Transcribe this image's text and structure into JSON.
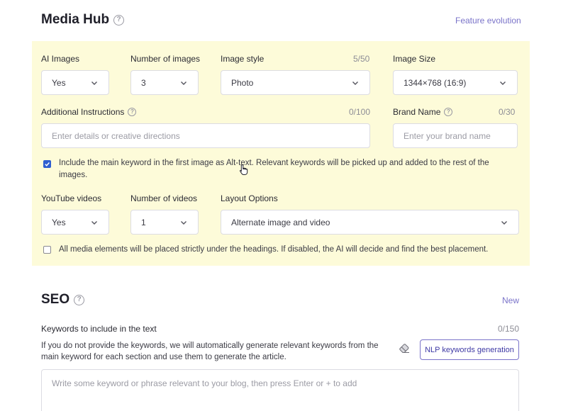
{
  "media_hub": {
    "title": "Media Hub",
    "feature_link": "Feature evolution",
    "ai_images": {
      "label": "AI Images",
      "value": "Yes"
    },
    "num_images": {
      "label": "Number of images",
      "value": "3"
    },
    "image_style": {
      "label": "Image style",
      "counter": "5/50",
      "value": "Photo"
    },
    "image_size": {
      "label": "Image Size",
      "value": "1344×768 (16:9)"
    },
    "additional_instructions": {
      "label": "Additional Instructions",
      "counter": "0/100",
      "placeholder": "Enter details or creative directions"
    },
    "brand_name": {
      "label": "Brand Name",
      "counter": "0/30",
      "placeholder": "Enter your brand name"
    },
    "alt_text_option": {
      "checked": true,
      "text": "Include the main keyword in the first image as Alt-text. Relevant keywords will be picked up and added to the rest of the images."
    },
    "youtube_videos": {
      "label": "YouTube videos",
      "value": "Yes"
    },
    "num_videos": {
      "label": "Number of videos",
      "value": "1"
    },
    "layout_options": {
      "label": "Layout Options",
      "value": "Alternate image and video"
    },
    "placement_option": {
      "checked": false,
      "text": "All media elements will be placed strictly under the headings. If disabled, the AI will decide and find the best placement."
    }
  },
  "seo": {
    "title": "SEO",
    "new_link": "New",
    "keywords_label": "Keywords to include in the text",
    "keywords_counter": "0/150",
    "help_text": "If you do not provide the keywords, we will automatically generate relevant keywords from the main keyword for each section and use them to generate the article.",
    "nlp_button": "NLP keywords generation",
    "keywords_placeholder": "Write some keyword or phrase relevant to your blog, then press Enter or + to add"
  },
  "icons": {
    "help": "help-circle-icon",
    "chevron": "chevron-down-icon",
    "eraser": "eraser-icon",
    "check": "check-icon",
    "cursor": "hand-pointer-icon"
  },
  "colors": {
    "panel_bg": "#fdfbd9",
    "accent": "#7a73c9",
    "checkbox": "#2f5fd0"
  }
}
